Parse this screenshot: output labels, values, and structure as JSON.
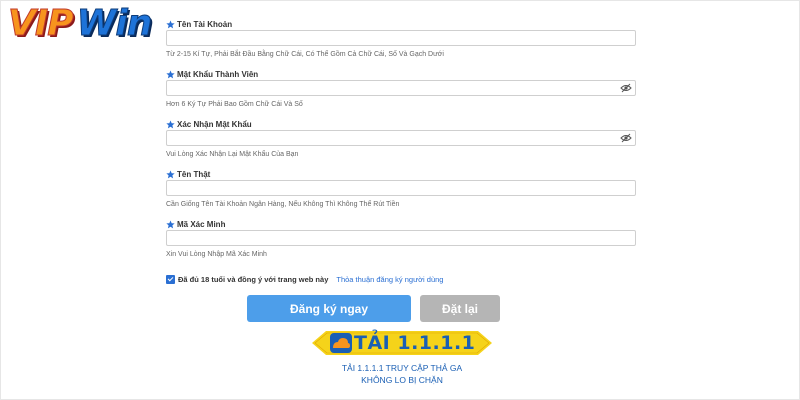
{
  "logo": {
    "part1": "VIP",
    "part2": "Win"
  },
  "form": {
    "fields": [
      {
        "label": "Tên Tài Khoản",
        "hint": "Từ 2-15 Kí Tự, Phải Bắt Đầu Bằng Chữ Cái, Có Thể Gồm Cả Chữ Cái, Số Và Gạch Dưới",
        "value": "",
        "has_eye": false
      },
      {
        "label": "Mật Khẩu Thành Viên",
        "hint": "Hơn 6 Ký Tự Phải Bao Gồm Chữ Cái Và Số",
        "value": "",
        "has_eye": true
      },
      {
        "label": "Xác Nhận Mật Khẩu",
        "hint": "Vui Lòng Xác Nhận Lại Mật Khẩu Của Bạn",
        "value": "",
        "has_eye": true
      },
      {
        "label": "Tên Thật",
        "hint": "Cần Giống Tên Tài Khoản Ngân Hàng, Nếu Không Thì Không Thể Rút Tiền",
        "value": "",
        "has_eye": false
      },
      {
        "label": "Mã Xác Minh",
        "hint": "Xin Vui Lòng Nhập Mã Xác Minh",
        "value": "",
        "has_eye": false
      }
    ],
    "agree_checked": true,
    "agree_text": "Đã đủ 18 tuổi và đồng ý với trang web này",
    "agree_link": "Thỏa thuận đăng ký người dùng"
  },
  "buttons": {
    "register": "Đăng ký ngay",
    "reset": "Đặt lại"
  },
  "banner": {
    "logo_char": "1",
    "text": "TẢI 1.1.1.1",
    "caption_line1": "TẢI 1.1.1.1 TRUY CẬP THẢ GA",
    "caption_line2": "KHÔNG LO BỊ CHẶN"
  },
  "colors": {
    "accent": "#4d9eea",
    "reset": "#b5b5b5",
    "link": "#2a6fd3",
    "banner_yellow": "#f5d31a",
    "star": "#2a6fd3"
  },
  "icons": {
    "label_marker": "star-icon",
    "password_toggle": "eye-slash-icon"
  }
}
